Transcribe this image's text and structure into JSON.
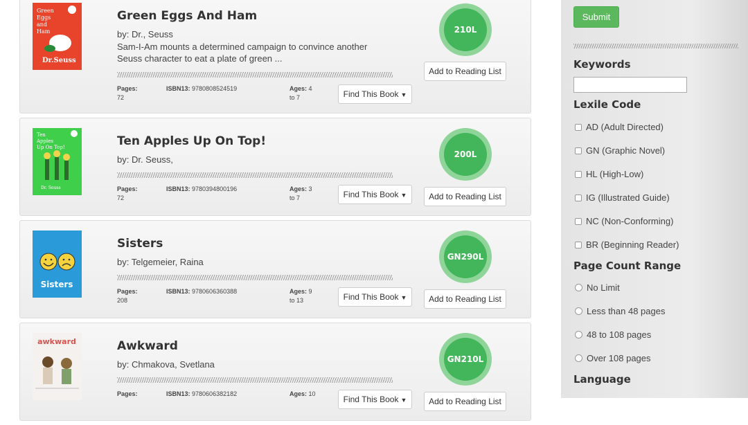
{
  "books": [
    {
      "title": "Green Eggs And Ham",
      "author": "by: Dr., Seuss",
      "description": "Sam-I-Am mounts a determined campaign to convince another Seuss character to eat a plate of green ...",
      "pages_label": "Pages:",
      "pages": "72",
      "isbn_label": "ISBN13:",
      "isbn": "9780808524519",
      "ages_label": "Ages:",
      "ages_from": "4",
      "ages_to": "to 7",
      "find_label": "Find This Book",
      "add_label": "Add to Reading List",
      "lexile": "210L",
      "cover_color": "#e8442c"
    },
    {
      "title": "Ten Apples Up On Top!",
      "author": "by: Dr. Seuss,",
      "description": "",
      "pages_label": "Pages:",
      "pages": "72",
      "isbn_label": "ISBN13:",
      "isbn": "9780394800196",
      "ages_label": "Ages:",
      "ages_from": "3",
      "ages_to": "to 7",
      "find_label": "Find This Book",
      "add_label": "Add to Reading List",
      "lexile": "200L",
      "cover_color": "#3fcf4a"
    },
    {
      "title": "Sisters",
      "author": "by: Telgemeier, Raina",
      "description": "",
      "pages_label": "Pages:",
      "pages": "208",
      "isbn_label": "ISBN13:",
      "isbn": "9780606360388",
      "ages_label": "Ages:",
      "ages_from": "9",
      "ages_to": "to 13",
      "find_label": "Find This Book",
      "add_label": "Add to Reading List",
      "lexile": "GN290L",
      "cover_color": "#2a9ad8",
      "cover_text": "Sisters"
    },
    {
      "title": "Awkward",
      "author": "by: Chmakova, Svetlana",
      "description": "",
      "pages_label": "Pages:",
      "pages": "",
      "isbn_label": "ISBN13:",
      "isbn": "9780606382182",
      "ages_label": "Ages:",
      "ages_from": "10",
      "ages_to": "",
      "find_label": "Find This Book",
      "add_label": "Add to Reading List",
      "lexile": "GN210L",
      "cover_color": "#f4f1ee",
      "cover_text": "awkward"
    }
  ],
  "sidebar": {
    "submit_label": "Submit",
    "keywords_heading": "Keywords",
    "keywords_value": "",
    "lexile_heading": "Lexile Code",
    "lexile_options": [
      "AD (Adult Directed)",
      "GN (Graphic Novel)",
      "HL (High-Low)",
      "IG (Illustrated Guide)",
      "NC (Non-Conforming)",
      "BR (Beginning Reader)"
    ],
    "page_count_heading": "Page Count Range",
    "page_count_options": [
      "No Limit",
      "Less than 48 pages",
      "48 to 108 pages",
      "Over 108 pages"
    ],
    "language_heading": "Language"
  },
  "colors": {
    "lexile_outer": "#8fd59a",
    "lexile_inner": "#43b55a",
    "submit_bg": "#5cb85c"
  }
}
